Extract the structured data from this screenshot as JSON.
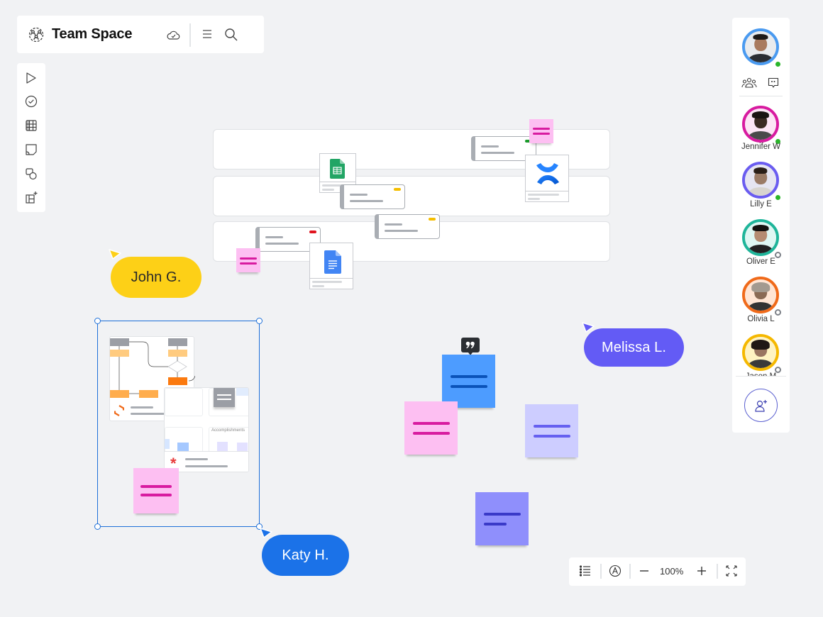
{
  "header": {
    "title": "Team Space",
    "icons": [
      "team-icon",
      "cloud-saved-icon",
      "menu-icon",
      "search-icon"
    ]
  },
  "toolbar": {
    "tools": [
      {
        "name": "select-tool",
        "icon": "pointer-icon"
      },
      {
        "name": "task-tool",
        "icon": "check-circle-icon"
      },
      {
        "name": "table-tool",
        "icon": "table-icon"
      },
      {
        "name": "sticky-note-tool",
        "icon": "sticky-note-icon"
      },
      {
        "name": "shapes-tool",
        "icon": "shapes-icon"
      },
      {
        "name": "add-template-tool",
        "icon": "add-frame-icon"
      }
    ]
  },
  "collaborators": {
    "current_user": {
      "status": "online",
      "ring_color": "#4a9af0"
    },
    "actions": [
      "participants-icon",
      "comments-icon"
    ],
    "people": [
      {
        "name": "Jennifer W",
        "ring_color": "#d81ba0",
        "status": "online"
      },
      {
        "name": "Lilly E",
        "ring_color": "#6a5cf0",
        "status": "online"
      },
      {
        "name": "Oliver E",
        "ring_color": "#1fb59a",
        "status": "away"
      },
      {
        "name": "Olivia L",
        "ring_color": "#f06a1a",
        "status": "away"
      },
      {
        "name": "Jason M",
        "ring_color": "#f5b800",
        "status": "away"
      }
    ],
    "invite_icon": "add-user-icon"
  },
  "canvas": {
    "cursors": [
      {
        "label": "John G.",
        "color": "#fdd017",
        "text_color": "#2a2a2a"
      },
      {
        "label": "Melissa L.",
        "color": "#635bf5",
        "text_color": "#ffffff"
      },
      {
        "label": "Katy H.",
        "color": "#1b72e8",
        "text_color": "#ffffff"
      }
    ],
    "card_tags": [
      "green",
      "yellow",
      "yellow",
      "red"
    ],
    "embedded_docs": [
      "google-sheets-icon",
      "confluence-icon",
      "google-docs-icon"
    ],
    "selection_panel_label": "Accomplishments",
    "comment_icon": "quote-icon",
    "sticky_colors": {
      "pink": "#fdbff2",
      "blue": "#4d9cff",
      "lavender": "#cdcdff",
      "violet": "#8f8ffc"
    }
  },
  "zoom_bar": {
    "zoom_level": "100%",
    "icons": [
      "outline-list-icon",
      "navigator-icon",
      "zoom-out-icon",
      "zoom-in-icon",
      "fullscreen-icon"
    ]
  }
}
